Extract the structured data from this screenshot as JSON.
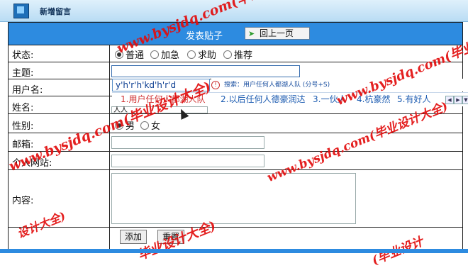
{
  "window": {
    "title": "新增留言"
  },
  "form_header": {
    "text": "发表贴子",
    "back_button": "回上一页"
  },
  "fields": {
    "status": {
      "label": "状态:",
      "options": [
        "普通",
        "加急",
        "求助",
        "推荐"
      ],
      "selected": "普通"
    },
    "subject": {
      "label": "主题:",
      "value": ""
    },
    "username": {
      "label": "用户名:"
    },
    "name": {
      "label": "姓名:",
      "value": "人人"
    },
    "gender": {
      "label": "性别:",
      "options": [
        "男",
        "女"
      ],
      "selected": "男"
    },
    "email": {
      "label": "邮箱:",
      "value": ""
    },
    "website": {
      "label": "个人网站:",
      "value": ""
    },
    "content": {
      "label": "内容:",
      "value": ""
    }
  },
  "buttons": {
    "submit": "添加",
    "reset": "重置"
  },
  "ime": {
    "composition": "y'h'r'h'kd'h'r'd",
    "search": "搜索：用户任何人都湖人队 (分号+S)",
    "candidates": [
      "1.用户任何人都湖人队",
      "2.以后任何人德豪润达",
      "3.一伙人",
      "4.杭豪然",
      "5.有好人"
    ]
  },
  "watermarks": [
    "www.bysjdq.com(毕业设计大全)",
    "www.bysjdq.com(毕业设计",
    "www.bysjdq.com(毕业设计大全)",
    "www.bysjdq.com(毕业设计大全)",
    "设计大全)",
    "毕业设计大全)",
    "计大全)",
    "(毕业设计"
  ]
}
